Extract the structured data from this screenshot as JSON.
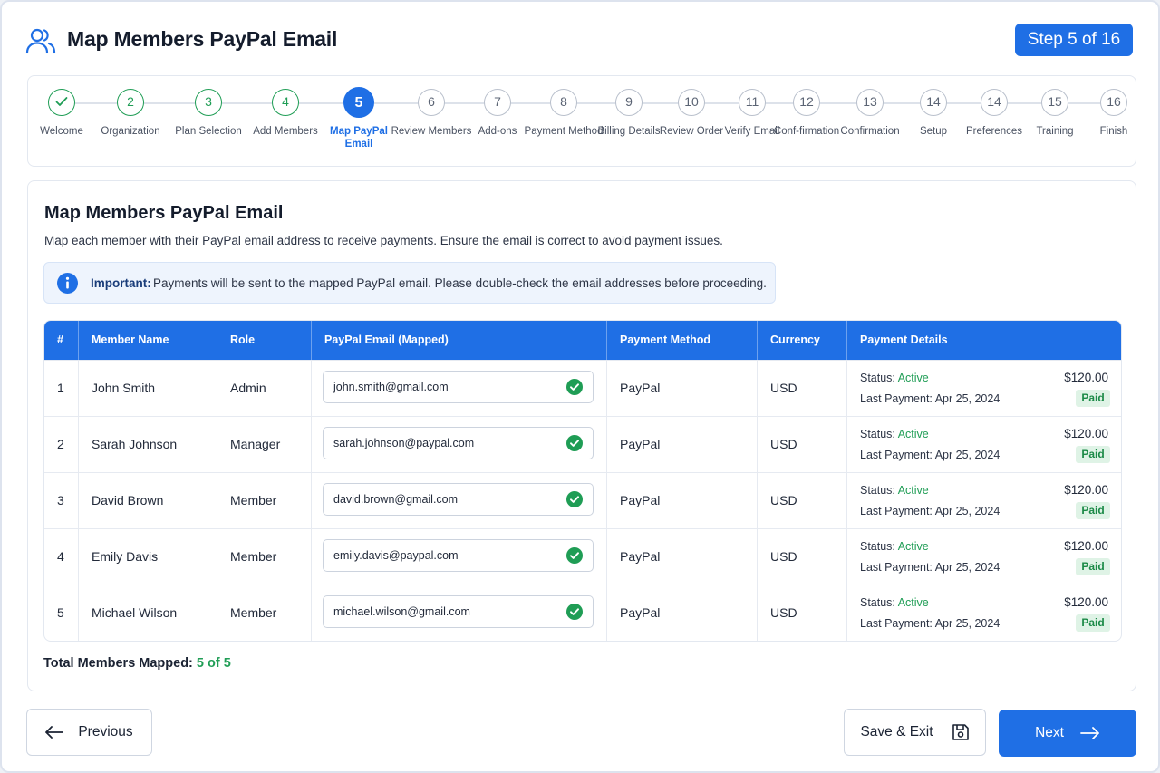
{
  "header": {
    "title": "Map Members PayPal Email",
    "step_badge": "Step 5 of 16",
    "icon": "users-icon"
  },
  "stepper": {
    "steps": [
      {
        "num": "✓",
        "label": "Welcome",
        "state": "done"
      },
      {
        "num": "2",
        "label": "Organization",
        "state": "done"
      },
      {
        "num": "3",
        "label": "Plan Selection",
        "state": "done"
      },
      {
        "num": "4",
        "label": "Add Members",
        "state": "done"
      },
      {
        "num": "5",
        "label": "Map PayPal Email",
        "state": "active"
      },
      {
        "num": "6",
        "label": "Review Members",
        "state": "pending"
      },
      {
        "num": "7",
        "label": "Add-ons",
        "state": "pending"
      },
      {
        "num": "8",
        "label": "Payment Method",
        "state": "pending"
      },
      {
        "num": "9",
        "label": "Billing Details",
        "state": "pending"
      },
      {
        "num": "10",
        "label": "Review Order",
        "state": "pending"
      },
      {
        "num": "11",
        "label": "Verify Email",
        "state": "pending"
      },
      {
        "num": "12",
        "label": "Conf-firmation",
        "state": "pending"
      },
      {
        "num": "13",
        "label": "Confirmation",
        "state": "pending"
      },
      {
        "num": "14",
        "label": "Setup",
        "state": "pending"
      },
      {
        "num": "14",
        "label": "Preferences",
        "state": "pending"
      },
      {
        "num": "15",
        "label": "Training",
        "state": "pending"
      },
      {
        "num": "16",
        "label": "Finish",
        "state": "pending"
      }
    ]
  },
  "card": {
    "title": "Map Members PayPal Email",
    "description": "Map each member with their PayPal email address to receive payments. Ensure the email is correct to avoid payment issues.",
    "notice_bold": "Important:",
    "notice_text": "Payments will be sent to the mapped PayPal email. Please double-check the email addresses before proceeding."
  },
  "table": {
    "headers": [
      "#",
      "Member Name",
      "Role",
      "PayPal Email (Mapped)",
      "Payment Method",
      "Currency",
      "Payment Details"
    ],
    "status_label": "Status:",
    "last_payment_label": "Last Payment:",
    "rows": [
      {
        "num": "1",
        "name": "John Smith",
        "role": "Admin",
        "email": "john.smith@gmail.com",
        "method": "PayPal",
        "currency": "USD",
        "status": "Active",
        "last_payment": "Apr 25, 2024",
        "amount": "$120.00",
        "badge": "Paid"
      },
      {
        "num": "2",
        "name": "Sarah Johnson",
        "role": "Manager",
        "email": "sarah.johnson@paypal.com",
        "method": "PayPal",
        "currency": "USD",
        "status": "Active",
        "last_payment": "Apr 25, 2024",
        "amount": "$120.00",
        "badge": "Paid"
      },
      {
        "num": "3",
        "name": "David Brown",
        "role": "Member",
        "email": "david.brown@gmail.com",
        "method": "PayPal",
        "currency": "USD",
        "status": "Active",
        "last_payment": "Apr 25, 2024",
        "amount": "$120.00",
        "badge": "Paid"
      },
      {
        "num": "4",
        "name": "Emily Davis",
        "role": "Member",
        "email": "emily.davis@paypal.com",
        "method": "PayPal",
        "currency": "USD",
        "status": "Active",
        "last_payment": "Apr 25, 2024",
        "amount": "$120.00",
        "badge": "Paid"
      },
      {
        "num": "5",
        "name": "Michael Wilson",
        "role": "Member",
        "email": "michael.wilson@gmail.com",
        "method": "PayPal",
        "currency": "USD",
        "status": "Active",
        "last_payment": "Apr 25, 2024",
        "amount": "$120.00",
        "badge": "Paid"
      }
    ]
  },
  "total": {
    "label": "Total Members Mapped:",
    "value": "5 of 5"
  },
  "footer": {
    "previous_label": "Previous",
    "save_label": "Save & Exit",
    "next_label": "Next"
  },
  "colors": {
    "primary": "#1f6fe5",
    "success": "#1f9d55",
    "paid_bg": "#dff3e6"
  }
}
